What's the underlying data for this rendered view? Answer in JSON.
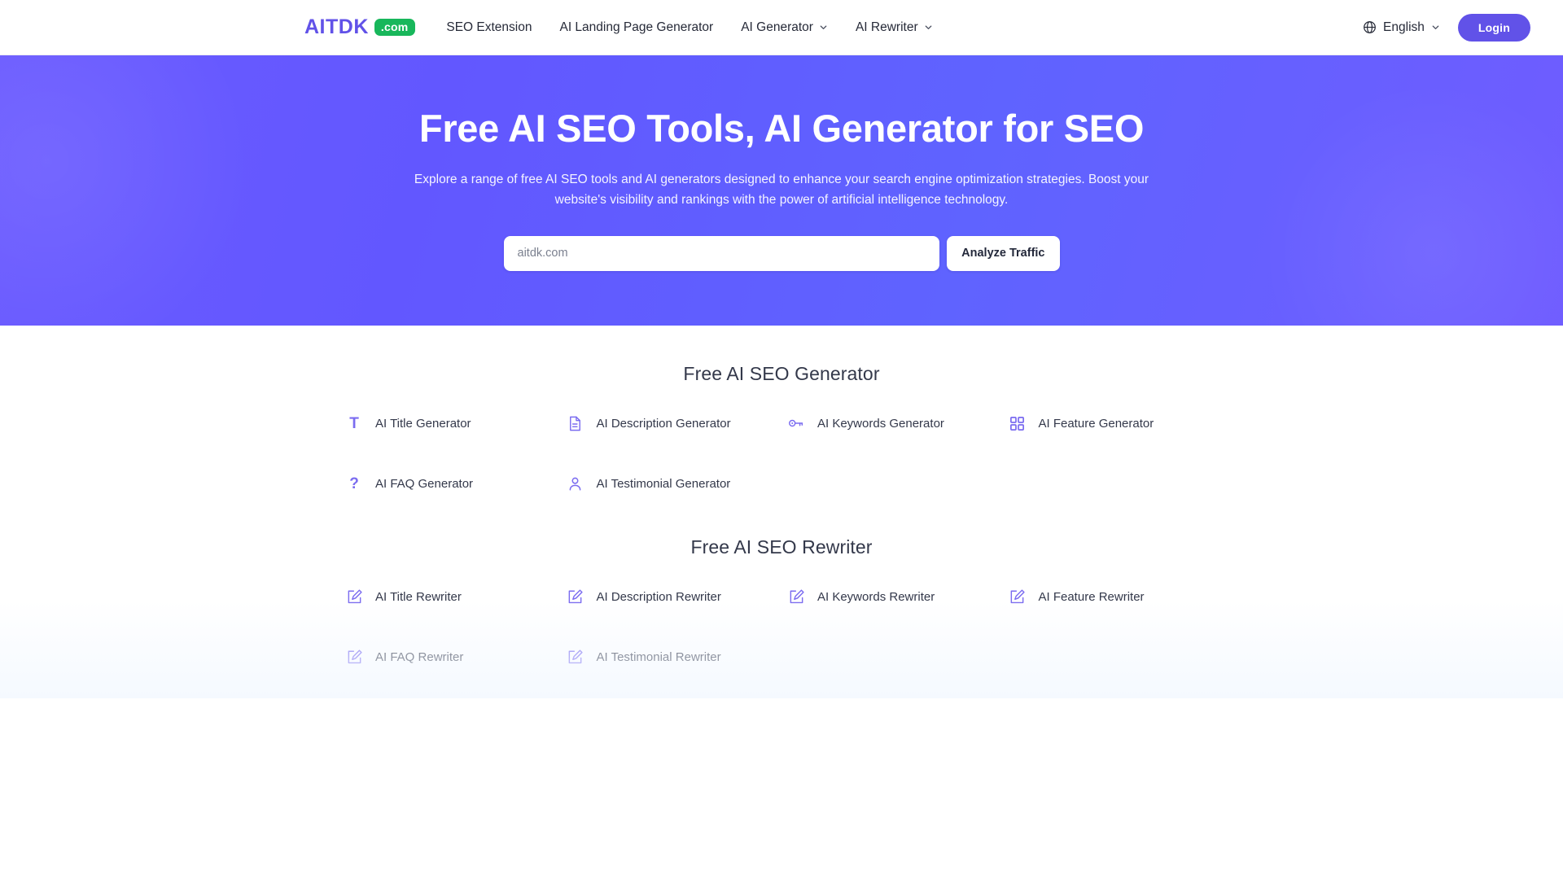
{
  "header": {
    "logo": {
      "word": "AITDK",
      "badge": ".com"
    },
    "nav": [
      {
        "label": "SEO Extension",
        "has_chevron": false,
        "icon": ""
      },
      {
        "label": "AI Landing Page Generator",
        "has_chevron": false,
        "icon": ""
      },
      {
        "label": "AI Generator",
        "has_chevron": true,
        "icon": "chevron-down-icon"
      },
      {
        "label": "AI Rewriter",
        "has_chevron": true,
        "icon": "chevron-down-icon"
      }
    ],
    "language": {
      "label": "English",
      "icon": "globe-icon"
    },
    "login_label": "Login"
  },
  "hero": {
    "title": "Free AI SEO Tools, AI Generator for SEO",
    "subtitle": "Explore a range of free AI SEO tools and AI generators designed to enhance your search engine optimization strategies. Boost your website's visibility and rankings with the power of artificial intelligence technology.",
    "search": {
      "value": "",
      "placeholder": "aitdk.com"
    },
    "analyze_label": "Analyze Traffic"
  },
  "generator_section": {
    "title": "Free AI SEO Generator",
    "tools": [
      {
        "label": "AI Title Generator",
        "icon": "title-letter-t-icon"
      },
      {
        "label": "AI Description Generator",
        "icon": "document-icon"
      },
      {
        "label": "AI Keywords Generator",
        "icon": "key-icon"
      },
      {
        "label": "AI Feature Generator",
        "icon": "grid-squares-icon"
      },
      {
        "label": "AI FAQ Generator",
        "icon": "question-mark-icon"
      },
      {
        "label": "AI Testimonial Generator",
        "icon": "user-icon"
      }
    ]
  },
  "rewriter_section": {
    "title": "Free AI SEO Rewriter",
    "tools": [
      {
        "label": "AI Title Rewriter",
        "icon": "edit-square-icon"
      },
      {
        "label": "AI Description Rewriter",
        "icon": "edit-square-icon"
      },
      {
        "label": "AI Keywords Rewriter",
        "icon": "edit-square-icon"
      },
      {
        "label": "AI Feature Rewriter",
        "icon": "edit-square-icon"
      },
      {
        "label": "AI FAQ Rewriter",
        "icon": "edit-square-icon"
      },
      {
        "label": "AI Testimonial Rewriter",
        "icon": "edit-square-icon"
      }
    ]
  },
  "colors": {
    "brand_purple": "#6152e8",
    "badge_green": "#18b75b",
    "hero_gradient_from": "#6b5bff",
    "hero_gradient_to": "#6f5cff",
    "icon_purple": "#7b6cf0"
  }
}
